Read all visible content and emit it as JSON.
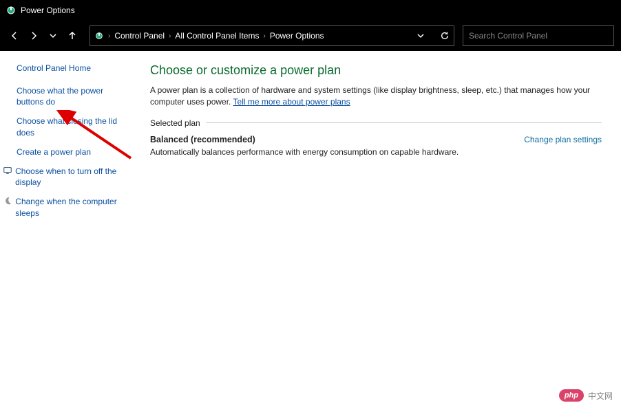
{
  "window": {
    "title": "Power Options"
  },
  "breadcrumbs": {
    "items": [
      "Control Panel",
      "All Control Panel Items",
      "Power Options"
    ]
  },
  "search": {
    "placeholder": "Search Control Panel"
  },
  "sidebar": {
    "home": "Control Panel Home",
    "items": [
      {
        "label": "Choose what the power buttons do",
        "icon": ""
      },
      {
        "label": "Choose what closing the lid does",
        "icon": ""
      },
      {
        "label": "Create a power plan",
        "icon": ""
      },
      {
        "label": "Choose when to turn off the display",
        "icon": "monitor"
      },
      {
        "label": "Change when the computer sleeps",
        "icon": "moon"
      }
    ]
  },
  "main": {
    "heading": "Choose or customize a power plan",
    "description": "A power plan is a collection of hardware and system settings (like display brightness, sleep, etc.) that manages how your computer uses power. ",
    "learn_more": "Tell me more about power plans",
    "section_label": "Selected plan",
    "plan_name": "Balanced (recommended)",
    "plan_desc": "Automatically balances performance with energy consumption on capable hardware.",
    "change_link": "Change plan settings"
  },
  "watermark": {
    "badge": "php",
    "text": "中文网"
  }
}
